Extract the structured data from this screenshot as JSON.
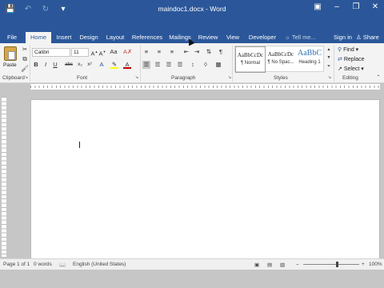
{
  "window": {
    "title": "maindoc1.docx - Word",
    "qat": [
      "save-icon",
      "undo-icon",
      "redo-icon",
      "customize-icon"
    ],
    "controls": [
      "ribbon-display-icon",
      "minimize-icon",
      "restore-icon",
      "close-icon"
    ]
  },
  "tabs": [
    "File",
    "Home",
    "Insert",
    "Design",
    "Layout",
    "References",
    "Mailings",
    "Review",
    "View",
    "Developer"
  ],
  "active_tab": "Home",
  "tell_me": "Tell me...",
  "sign_in": "Sign in",
  "share": "Share",
  "clipboard": {
    "paste": "Paste",
    "label": "Clipboard"
  },
  "font": {
    "name": "Calibri",
    "size": "11",
    "label": "Font",
    "buttons": [
      "B",
      "I",
      "U",
      "abc",
      "x₂",
      "x²"
    ]
  },
  "paragraph": {
    "label": "Paragraph",
    "pilcrow": "¶"
  },
  "styles": {
    "label": "Styles",
    "items": [
      {
        "sample": "AaBbCcDc",
        "name": "¶ Normal"
      },
      {
        "sample": "AaBbCcDc",
        "name": "¶ No Spac..."
      },
      {
        "sample": "AaBbC",
        "name": "Heading 1"
      }
    ]
  },
  "editing": {
    "label": "Editing",
    "items": [
      "Find",
      "Replace",
      "Select"
    ]
  },
  "status": {
    "page": "Page 1 of 1",
    "words": "0 words",
    "language": "English (United States)",
    "zoom": "100%"
  },
  "colors": {
    "accent": "#2b579a",
    "ribbon": "#f3f3f3",
    "background": "#c6c6c6"
  }
}
